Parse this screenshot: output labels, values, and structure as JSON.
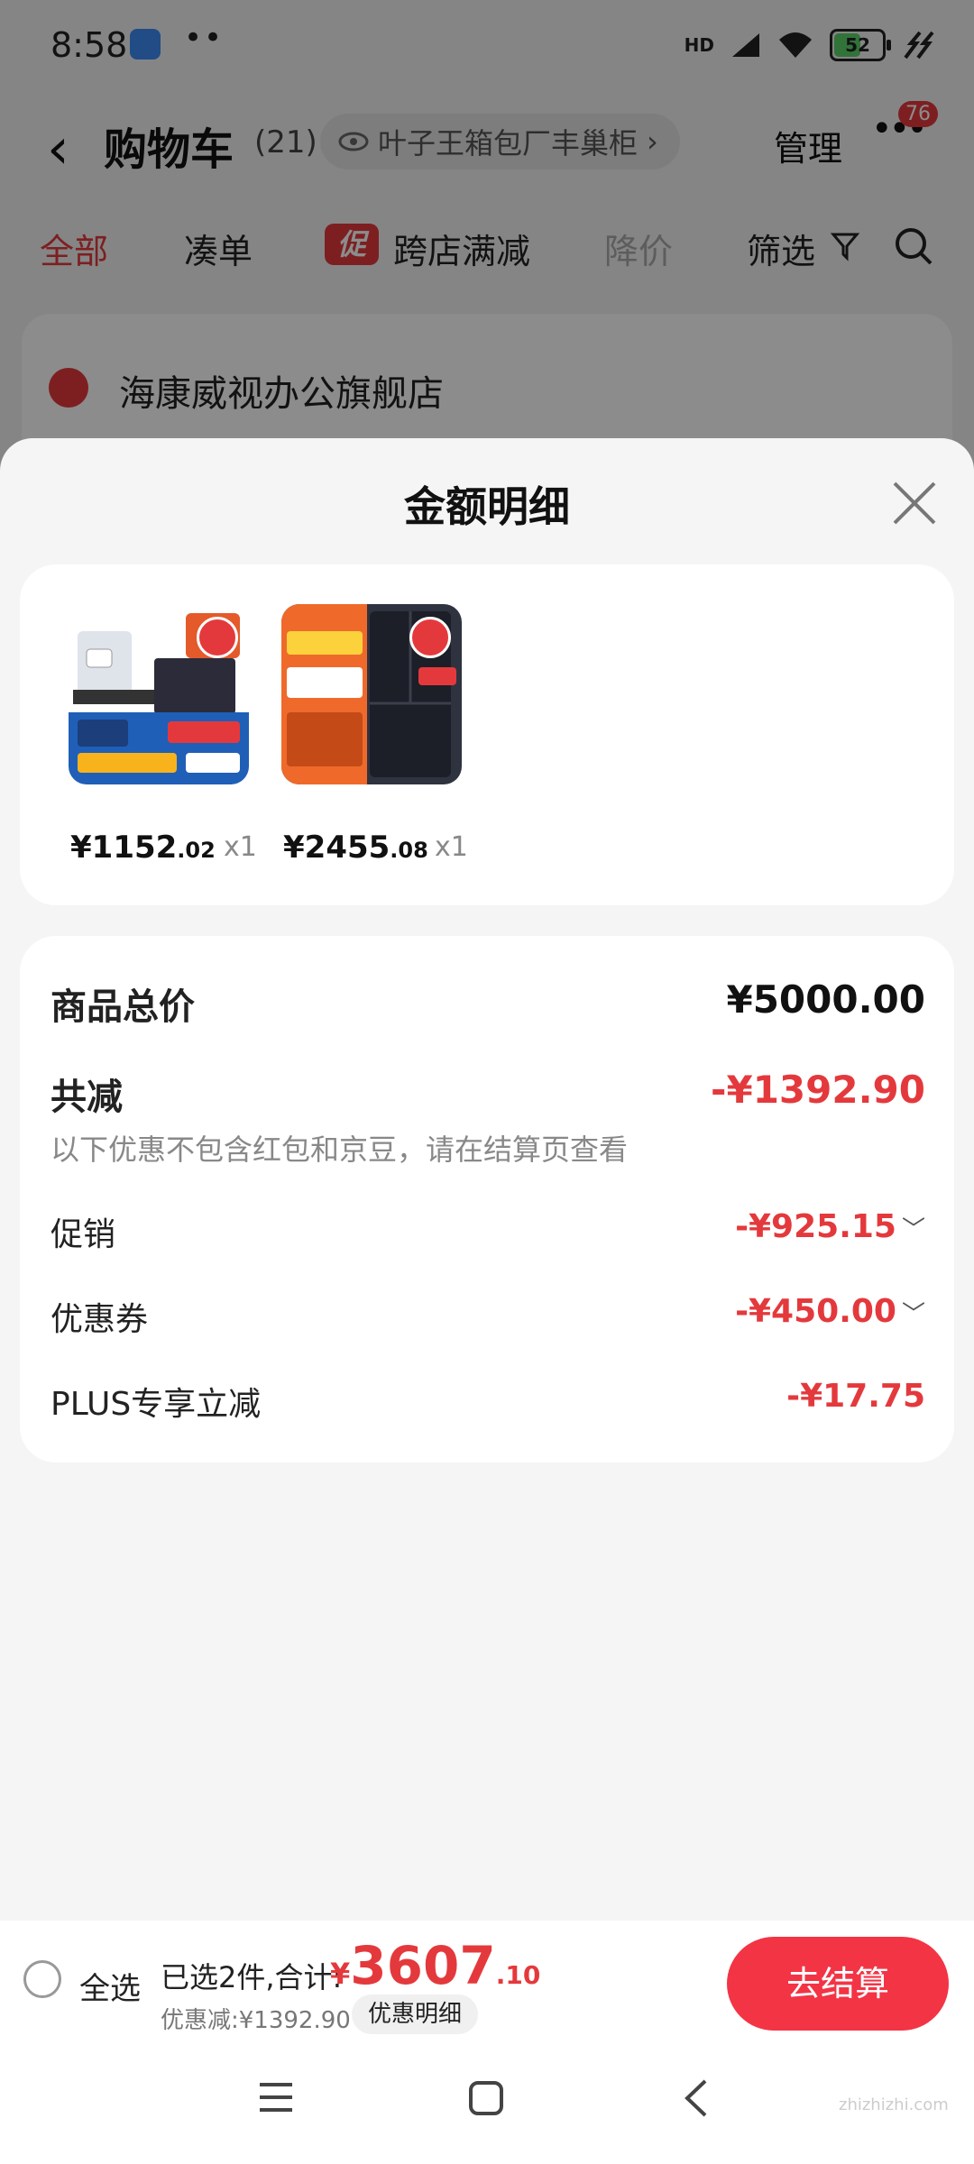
{
  "status_bar": {
    "time": "8:58",
    "battery": "52",
    "network": "HD"
  },
  "header": {
    "back_icon": "chevron-left-icon",
    "title": "购物车",
    "count": "(21)",
    "location": "叶子王箱包厂丰巢柜",
    "manage": "管理",
    "more_badge": "76"
  },
  "tabs": {
    "all": "全部",
    "combine": "凑单",
    "promo_tag": "促",
    "cross_store": "跨店满减",
    "price_drop": "降价",
    "filter": "筛选"
  },
  "store": {
    "name": "海康威视办公旗舰店"
  },
  "sheet": {
    "title": "金额明细",
    "products": [
      {
        "price_int": "¥1152",
        "price_dec": ".02",
        "qty": "x1"
      },
      {
        "price_int": "¥2455",
        "price_dec": ".08",
        "qty": "x1"
      }
    ],
    "summary": {
      "total_label": "商品总价",
      "total_value": "¥5000.00",
      "reduced_label": "共减",
      "reduced_value": "-¥1392.90",
      "note": "以下优惠不包含红包和京豆，请在结算页查看",
      "promo_label": "促销",
      "promo_value": "-¥925.15",
      "coupon_label": "优惠券",
      "coupon_value": "-¥450.00",
      "plus_label": "PLUS专享立减",
      "plus_value": "-¥17.75"
    }
  },
  "bottom_bar": {
    "select_all": "全选",
    "selected_text": "已选2件,合计:",
    "total_symbol": "¥",
    "total_int": "3607",
    "total_dec": ".10",
    "discount_text": "优惠减:¥1392.90",
    "detail_button": "优惠明细",
    "checkout_button": "去结算"
  },
  "watermark": "zhizhizhi.com",
  "colors": {
    "accent": "#e4393c",
    "checkout": "#f33445"
  }
}
